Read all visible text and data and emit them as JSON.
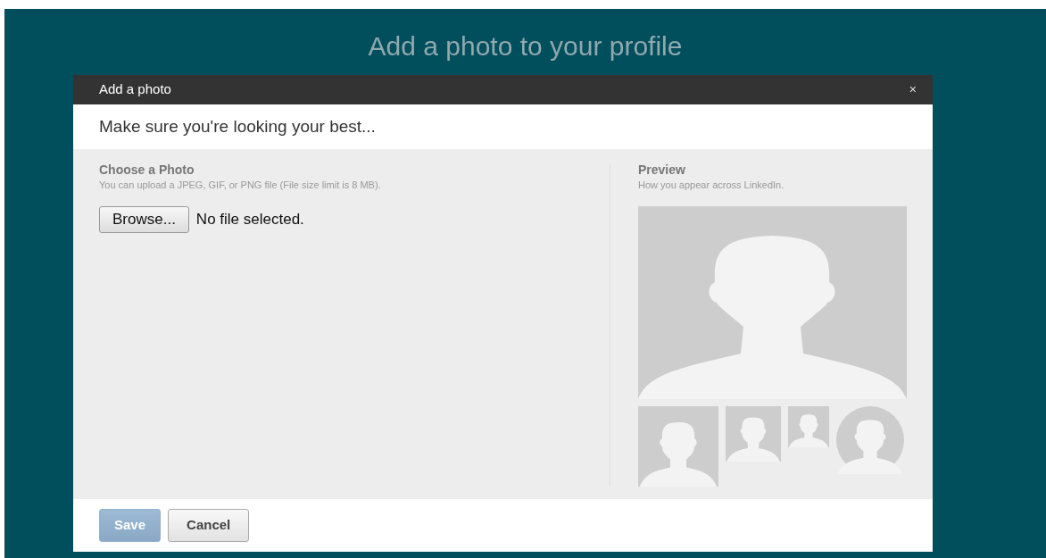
{
  "page": {
    "heading": "Add a photo to your profile"
  },
  "dialog": {
    "title": "Add a photo",
    "close": "×",
    "intro": "Make sure you're looking your best...",
    "choose": {
      "heading": "Choose a Photo",
      "hint": "You can upload a JPEG, GIF, or PNG file (File size limit is 8 MB).",
      "browse": "Browse...",
      "file_status": "No file selected."
    },
    "preview": {
      "heading": "Preview",
      "hint": "How you appear across LinkedIn.",
      "thumbnails": [
        {
          "kind": "square"
        },
        {
          "kind": "square"
        },
        {
          "kind": "square"
        },
        {
          "kind": "circle"
        }
      ]
    },
    "buttons": [
      {
        "label": "Save",
        "kind": "primary",
        "disabled": true
      },
      {
        "label": "Cancel",
        "kind": "secondary",
        "disabled": false
      }
    ]
  }
}
